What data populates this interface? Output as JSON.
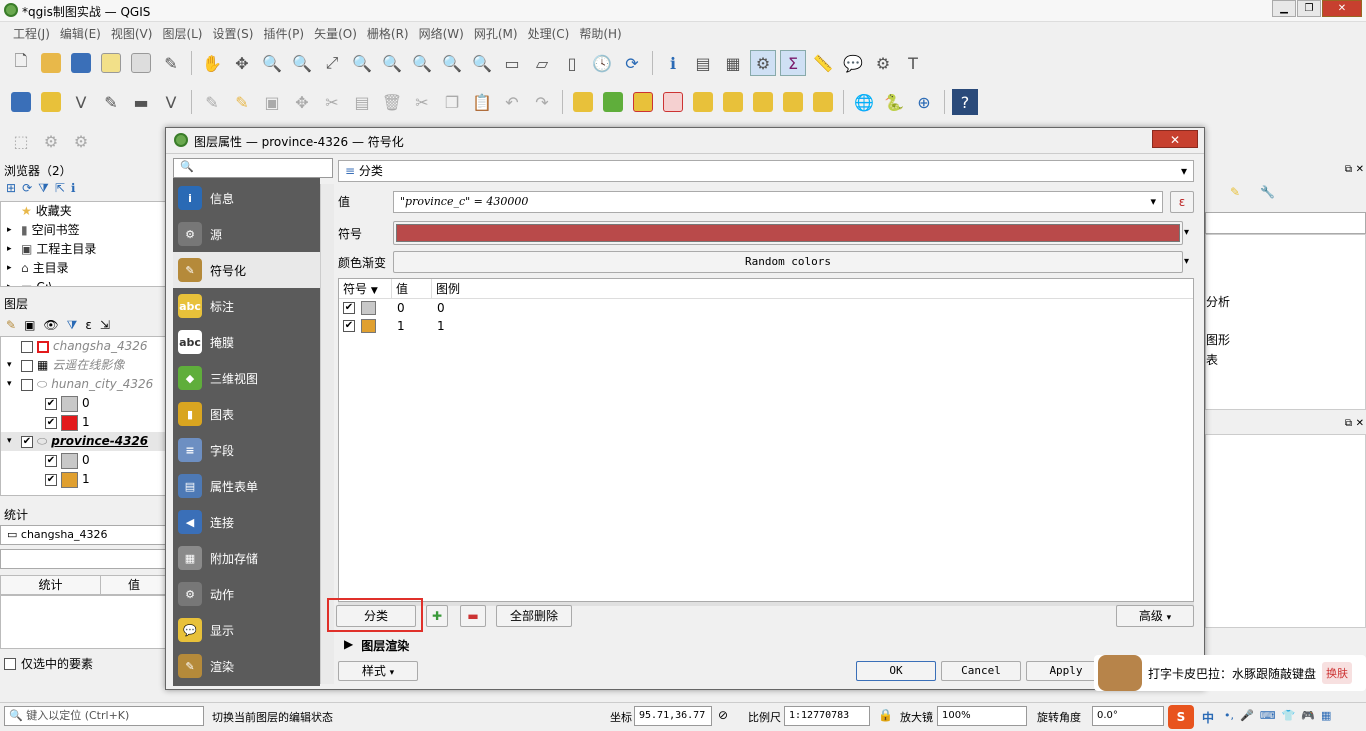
{
  "window": {
    "title": "*qgis制图实战 — QGIS"
  },
  "menu": [
    "工程(J)",
    "编辑(E)",
    "视图(V)",
    "图层(L)",
    "设置(S)",
    "插件(P)",
    "矢量(O)",
    "栅格(R)",
    "网络(W)",
    "网孔(M)",
    "处理(C)",
    "帮助(H)"
  ],
  "browser": {
    "title": "浏览器（2）",
    "items": [
      "收藏夹",
      "空间书签",
      "工程主目录",
      "主目录",
      "C:\\"
    ]
  },
  "layers_panel": {
    "title": "图层",
    "layers": [
      {
        "name": "changsha_4326",
        "checked": false
      },
      {
        "name": "云遥在线影像",
        "checked": false
      },
      {
        "name": "hunan_city_4326",
        "checked": false
      },
      {
        "name": "0",
        "checked": true,
        "color": "#c8c8c8"
      },
      {
        "name": "1",
        "checked": true,
        "color": "#e31a1c"
      },
      {
        "name": "province-4326",
        "checked": true
      },
      {
        "name": "0",
        "checked": true,
        "color": "#c8c8c8"
      },
      {
        "name": "1",
        "checked": true,
        "color": "#e0a030"
      }
    ]
  },
  "stats_panel": {
    "title": "统计",
    "layer": "changsha_4326",
    "col_stat": "统计",
    "col_value": "值",
    "selected_only": "仅选中的要素"
  },
  "dialog": {
    "title": "图层属性 — province-4326 — 符号化",
    "nav": [
      {
        "label": "信息",
        "icon": "info-icon",
        "color": "#2a6ab5",
        "glyph": "i"
      },
      {
        "label": "源",
        "icon": "source-icon",
        "color": "#777",
        "glyph": "⚙"
      },
      {
        "label": "符号化",
        "icon": "symbology-icon",
        "color": "#b58a3a",
        "glyph": "✎"
      },
      {
        "label": "标注",
        "icon": "label-icon",
        "color": "#e8c13a",
        "glyph": "abc"
      },
      {
        "label": "掩膜",
        "icon": "mask-icon",
        "color": "#ffffff",
        "glyph": "abc"
      },
      {
        "label": "三维视图",
        "icon": "3d-view-icon",
        "color": "#5fae3b",
        "glyph": "◆"
      },
      {
        "label": "图表",
        "icon": "diagram-icon",
        "color": "#d9a520",
        "glyph": "▮"
      },
      {
        "label": "字段",
        "icon": "fields-icon",
        "color": "#6d8fc2",
        "glyph": "≡"
      },
      {
        "label": "属性表单",
        "icon": "attribute-form-icon",
        "color": "#4d79b5",
        "glyph": "▤"
      },
      {
        "label": "连接",
        "icon": "join-icon",
        "color": "#3a6fb8",
        "glyph": "◀"
      },
      {
        "label": "附加存储",
        "icon": "auxiliary-storage-icon",
        "color": "#8a8a8a",
        "glyph": "▦"
      },
      {
        "label": "动作",
        "icon": "actions-icon",
        "color": "#777",
        "glyph": "⚙"
      },
      {
        "label": "显示",
        "icon": "display-icon",
        "color": "#e8c13a",
        "glyph": "💬"
      },
      {
        "label": "渲染",
        "icon": "rendering-icon",
        "color": "#b58a3a",
        "glyph": "✎"
      }
    ],
    "renderer": "分类",
    "value_label": "值",
    "value_expr": "\"province_c\" = 430000",
    "symbol_label": "符号",
    "symbol_color": "#b94a4a",
    "ramp_label": "颜色渐变",
    "ramp_value": "Random colors",
    "table_headers": [
      "符号",
      "值",
      "图例"
    ],
    "classes": [
      {
        "value": "0",
        "legend": "0",
        "color": "#c8c8c8",
        "checked": true
      },
      {
        "value": "1",
        "legend": "1",
        "color": "#e0a030",
        "checked": true
      }
    ],
    "classify_btn": "分类",
    "delete_all_btn": "全部删除",
    "advanced_btn": "高级",
    "layer_rendering": "图层渲染",
    "style_btn": "样式",
    "ok_btn": "OK",
    "cancel_btn": "Cancel",
    "apply_btn": "Apply"
  },
  "right_panel": {
    "texts": [
      "分析",
      "图形",
      "表"
    ]
  },
  "ime_tip": "打字卡皮巴拉：水豚跟随敲键盘",
  "ime_switch": "换肤",
  "status": {
    "locator_placeholder": "键入以定位 (Ctrl+K)",
    "message": "切换当前图层的编辑状态",
    "coord_label": "坐标",
    "coord_value": "95.71,36.77",
    "scale_label": "比例尺",
    "scale_value": "1:12770783",
    "magnifier_label": "放大镜",
    "magnifier_value": "100%",
    "rotation_label": "旋转角度",
    "rotation_value": "0.0°",
    "ime_lang": "中"
  }
}
